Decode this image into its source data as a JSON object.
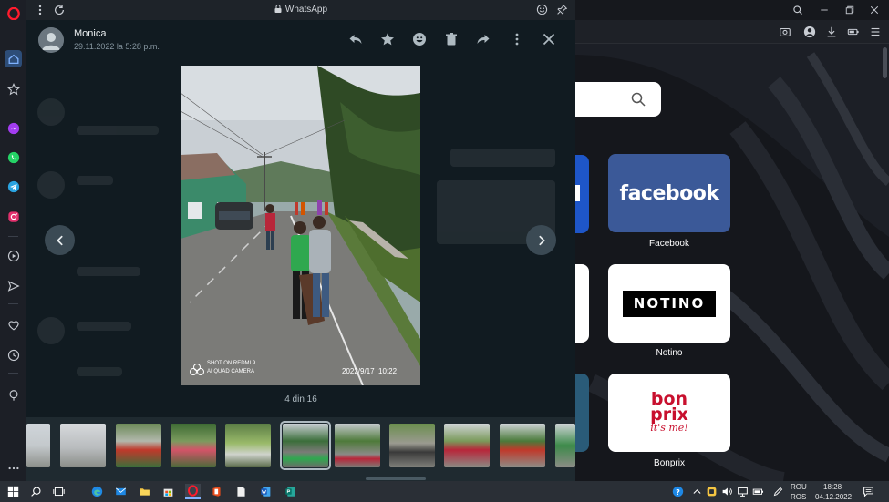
{
  "popup": {
    "title": "WhatsApp",
    "contact_name": "Monica",
    "timestamp": "29.11.2022 la 5:28 p.m.",
    "counter": "4 din 16"
  },
  "photo": {
    "watermark_line1": "SHOT ON REDMI 9",
    "watermark_line2": "AI QUAD CAMERA",
    "photo_date": "2022/9/17  10:22"
  },
  "speed_dial": {
    "tiles": [
      {
        "label": "Facebook",
        "logo_text": "facebook"
      },
      {
        "label": "Notino",
        "logo_text": "NOTINO"
      },
      {
        "label": "Bonprix",
        "logo_text_1": "bon",
        "logo_text_2": "prix",
        "logo_text_3": "it's me!"
      }
    ]
  },
  "taskbar": {
    "lang_1": "ROU",
    "lang_2": "ROS",
    "time": "18:28",
    "date": "04.12.2022"
  },
  "colors": {
    "wa_bg": "#111b21",
    "facebook_blue": "#3b5998",
    "bonprix_red": "#c8102e",
    "opera_red": "#ff1b2d"
  }
}
